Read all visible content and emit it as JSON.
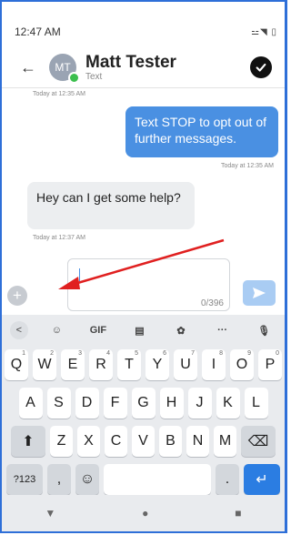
{
  "status": {
    "time": "12:47 AM",
    "icons": "⚍◥ ▯"
  },
  "header": {
    "back_icon": "arrow-left-icon",
    "avatar_initials": "MT",
    "name": "Matt Tester",
    "subtitle": "Text",
    "action_icon": "chat-check-icon"
  },
  "thread": {
    "top_timestamp": "Today at 12:35 AM",
    "outgoing_text": "Text STOP to opt out of further messages.",
    "outgoing_time": "Today at 12:35 AM",
    "incoming_text": "Hey can I get some help?",
    "incoming_time": "Today at 12:37 AM"
  },
  "composer": {
    "add_label": "+",
    "counter": "0/396",
    "send_icon": "send-arrow-icon"
  },
  "keyboard": {
    "toolbar": [
      "<",
      "☺",
      "GIF",
      "▤",
      "✿",
      "···",
      "🎙"
    ],
    "row1": [
      {
        "k": "Q",
        "n": "1"
      },
      {
        "k": "W",
        "n": "2"
      },
      {
        "k": "E",
        "n": "3"
      },
      {
        "k": "R",
        "n": "4"
      },
      {
        "k": "T",
        "n": "5"
      },
      {
        "k": "Y",
        "n": "6"
      },
      {
        "k": "U",
        "n": "7"
      },
      {
        "k": "I",
        "n": "8"
      },
      {
        "k": "O",
        "n": "9"
      },
      {
        "k": "P",
        "n": "0"
      }
    ],
    "row2": [
      "A",
      "S",
      "D",
      "F",
      "G",
      "H",
      "J",
      "K",
      "L"
    ],
    "row3": [
      "Z",
      "X",
      "C",
      "V",
      "B",
      "N",
      "M"
    ],
    "shift": "⬆",
    "backspace": "⌫",
    "symbols": "?123",
    "comma": ",",
    "emoji": "☺",
    "period": ".",
    "enter": "↵"
  },
  "navbar": {
    "back": "▼",
    "home": "●",
    "recents": "■"
  }
}
